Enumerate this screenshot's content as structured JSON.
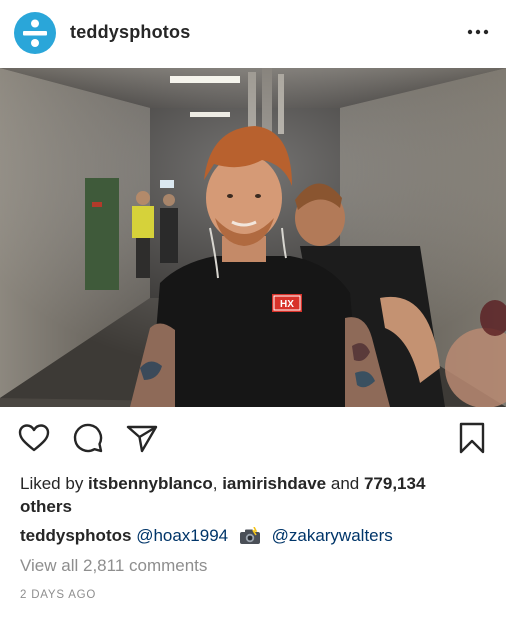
{
  "header": {
    "username": "teddysphotos",
    "more_icon": "more-horizontal-icon"
  },
  "photo": {
    "shirt_logo_text": "HX"
  },
  "actions": {
    "like_icon": "heart-icon",
    "comment_icon": "comment-icon",
    "share_icon": "send-icon",
    "save_icon": "bookmark-icon"
  },
  "likes": {
    "prefix": "Liked by ",
    "user1": "itsbennyblanco",
    "sep": ", ",
    "user2": "iamirishdave",
    "and": " and ",
    "count": "779,134",
    "suffix": "others"
  },
  "caption": {
    "username": "teddysphotos",
    "mention1": "@hoax1994",
    "emoji": "camera-with-flash-emoji",
    "mention2": "@zakarywalters"
  },
  "comments": {
    "view_all": "View all 2,811 comments"
  },
  "timestamp": "2 DAYS AGO",
  "colors": {
    "avatar_bg": "#2aa6d9",
    "text": "#262626",
    "muted": "#8e8e8e",
    "mention": "#003569"
  }
}
